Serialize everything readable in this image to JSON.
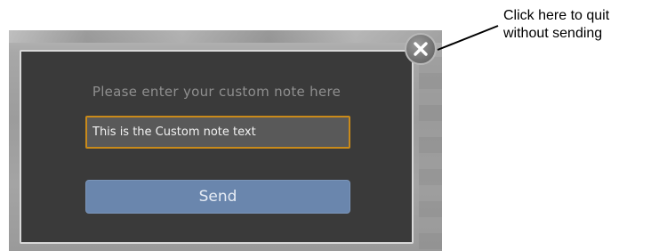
{
  "dialog": {
    "prompt": "Please enter your custom note here",
    "note_value": "This is the Custom note text",
    "send_label": "Send",
    "close_icon": "close-icon"
  },
  "annotation": {
    "line1": "Click here to quit",
    "line2": "without sending"
  },
  "colors": {
    "dialog_bg": "#3a3a3a",
    "input_border": "#c98a1a",
    "send_bg": "#6a86ad"
  }
}
